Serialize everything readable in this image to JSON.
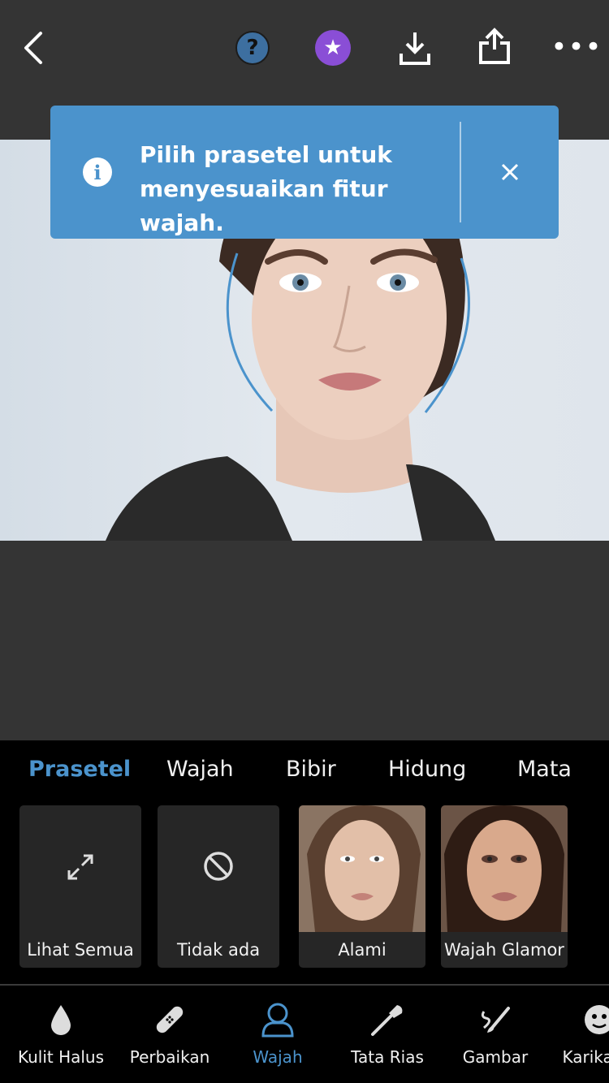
{
  "toolbar": {
    "back_icon": "chevron-left-icon",
    "help_label": "?",
    "premium_icon": "star-icon",
    "download_icon": "download-icon",
    "share_icon": "share-icon",
    "more_label": "•••"
  },
  "banner": {
    "message": "Pilih prasetel untuk menyesuaikan fitur wajah.",
    "info_label": "i",
    "close_icon": "close-icon",
    "color": "#4b93cc"
  },
  "tabs": [
    {
      "label": "Prasetel",
      "active": true
    },
    {
      "label": "Wajah"
    },
    {
      "label": "Bibir"
    },
    {
      "label": "Hidung"
    },
    {
      "label": "Mata"
    }
  ],
  "presets": [
    {
      "label": "Lihat Semua",
      "icon": "expand-icon"
    },
    {
      "label": "Tidak ada",
      "icon": "no-entry-icon"
    },
    {
      "label": "Alami"
    },
    {
      "label": "Wajah Glamor"
    }
  ],
  "bottom_nav": [
    {
      "label": "Kulit Halus",
      "icon": "drop-icon"
    },
    {
      "label": "Perbaikan",
      "icon": "bandage-icon"
    },
    {
      "label": "Wajah",
      "icon": "person-icon",
      "active": true
    },
    {
      "label": "Tata Rias",
      "icon": "makeup-brush-icon"
    },
    {
      "label": "Gambar",
      "icon": "paint-brush-icon"
    },
    {
      "label": "Karikatur",
      "icon": "caricature-face-icon"
    }
  ],
  "accent_color": "#4b93cc"
}
